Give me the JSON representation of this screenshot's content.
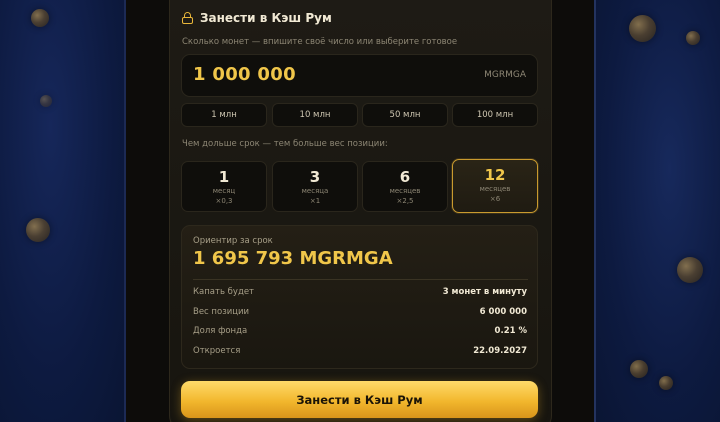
{
  "header": {
    "title": "Занести в Кэш Рум"
  },
  "amount": {
    "hint": "Сколько монет — впишите своё число или выберите готовое",
    "value": "1 000 000",
    "unit": "MGRMGA",
    "presets": [
      "1 млн",
      "10 млн",
      "50 млн",
      "100 млн"
    ]
  },
  "term": {
    "hint": "Чем дольше срок — тем больше вес позиции:",
    "options": [
      {
        "num": "1",
        "word": "месяц",
        "mult": "×0,3"
      },
      {
        "num": "3",
        "word": "месяца",
        "mult": "×1"
      },
      {
        "num": "6",
        "word": "месяцев",
        "mult": "×2,5"
      },
      {
        "num": "12",
        "word": "месяцев",
        "mult": "×6"
      }
    ],
    "selected": "12"
  },
  "summary": {
    "label": "Ориентир за срок",
    "value": "1 695 793 MGRMGA",
    "rows": [
      {
        "label": "Капать будет",
        "value": "3 монет в минуту"
      },
      {
        "label": "Вес позиции",
        "value": "6 000 000"
      },
      {
        "label": "Доля фонда",
        "value": "0.21 %"
      },
      {
        "label": "Откроется",
        "value": "22.09.2027"
      }
    ]
  },
  "cta": {
    "label": "Занести в Кэш Рум"
  },
  "colors": {
    "accent": "#f0c64a",
    "background": "#0e1a3c",
    "card": "#1e1b15"
  }
}
